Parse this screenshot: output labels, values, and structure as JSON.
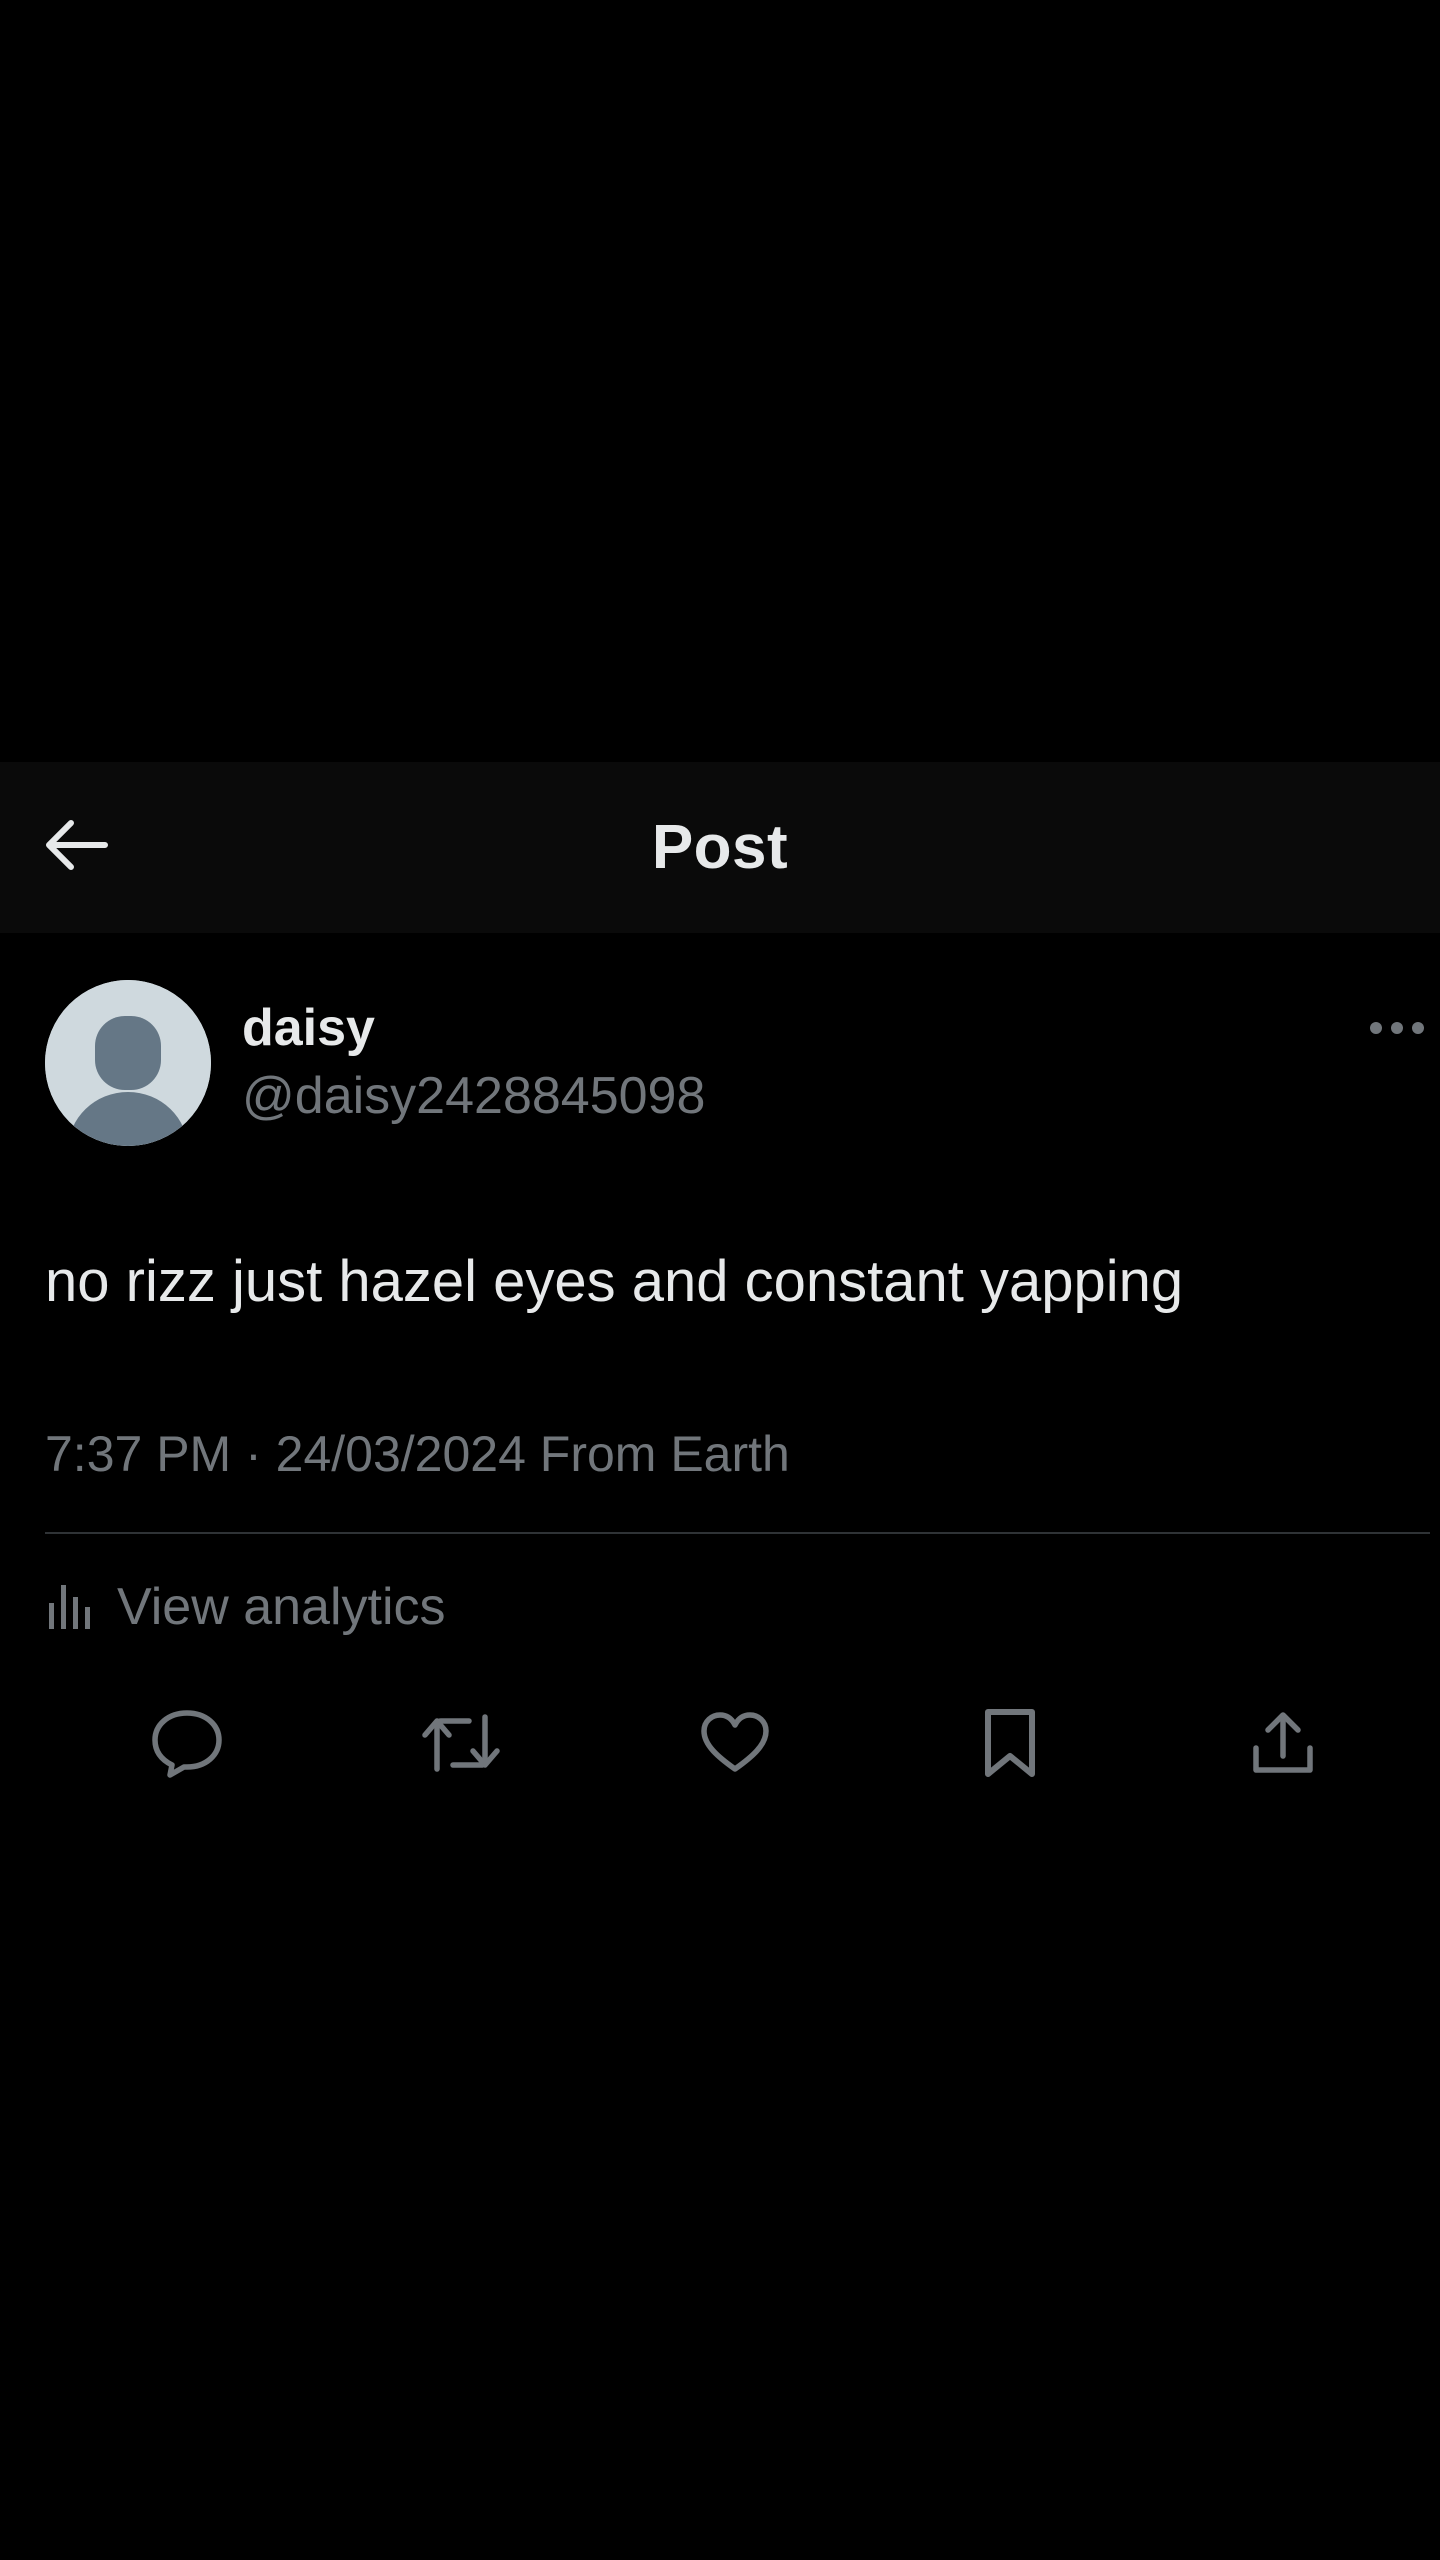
{
  "header": {
    "title": "Post",
    "back_icon": "arrow-left-icon"
  },
  "author": {
    "name": "daisy",
    "handle": "@daisy2428845098",
    "avatar_icon": "default-avatar-icon"
  },
  "post": {
    "text": "no rizz just hazel eyes and constant yapping",
    "meta": "7:37 PM · 24/03/2024 From Earth"
  },
  "analytics": {
    "label": "View analytics",
    "icon": "bar-chart-icon"
  },
  "actions": [
    {
      "name": "reply",
      "icon": "reply-icon"
    },
    {
      "name": "repost",
      "icon": "repost-icon"
    },
    {
      "name": "like",
      "icon": "heart-icon"
    },
    {
      "name": "bookmark",
      "icon": "bookmark-icon"
    },
    {
      "name": "share",
      "icon": "share-icon"
    }
  ],
  "colors": {
    "background": "#000000",
    "header_background": "#0a0a0a",
    "primary_text": "#e7e9ea",
    "secondary_text": "#71767b",
    "divider": "#2f3336"
  }
}
